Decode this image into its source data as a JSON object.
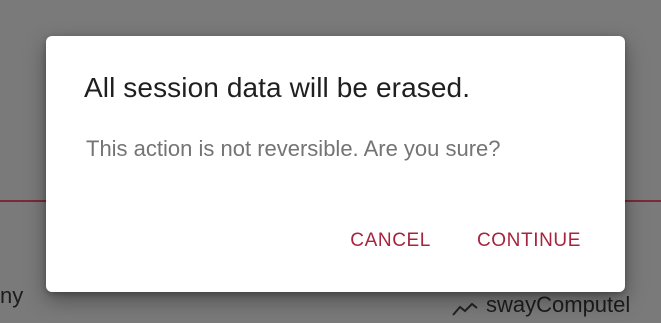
{
  "background": {
    "left_text": "ny",
    "right_item_label": "swayComputel",
    "right_item_icon": "trend-line-icon"
  },
  "dialog": {
    "title": "All session data will be erased.",
    "body": "This action is not reversible. Are you sure?",
    "actions": {
      "cancel_label": "CANCEL",
      "continue_label": "CONTINUE"
    }
  },
  "colors": {
    "accent": "#a8243e",
    "scrim": "#7a7a7a",
    "title_text": "#1f1f1f",
    "body_text": "#747474"
  }
}
